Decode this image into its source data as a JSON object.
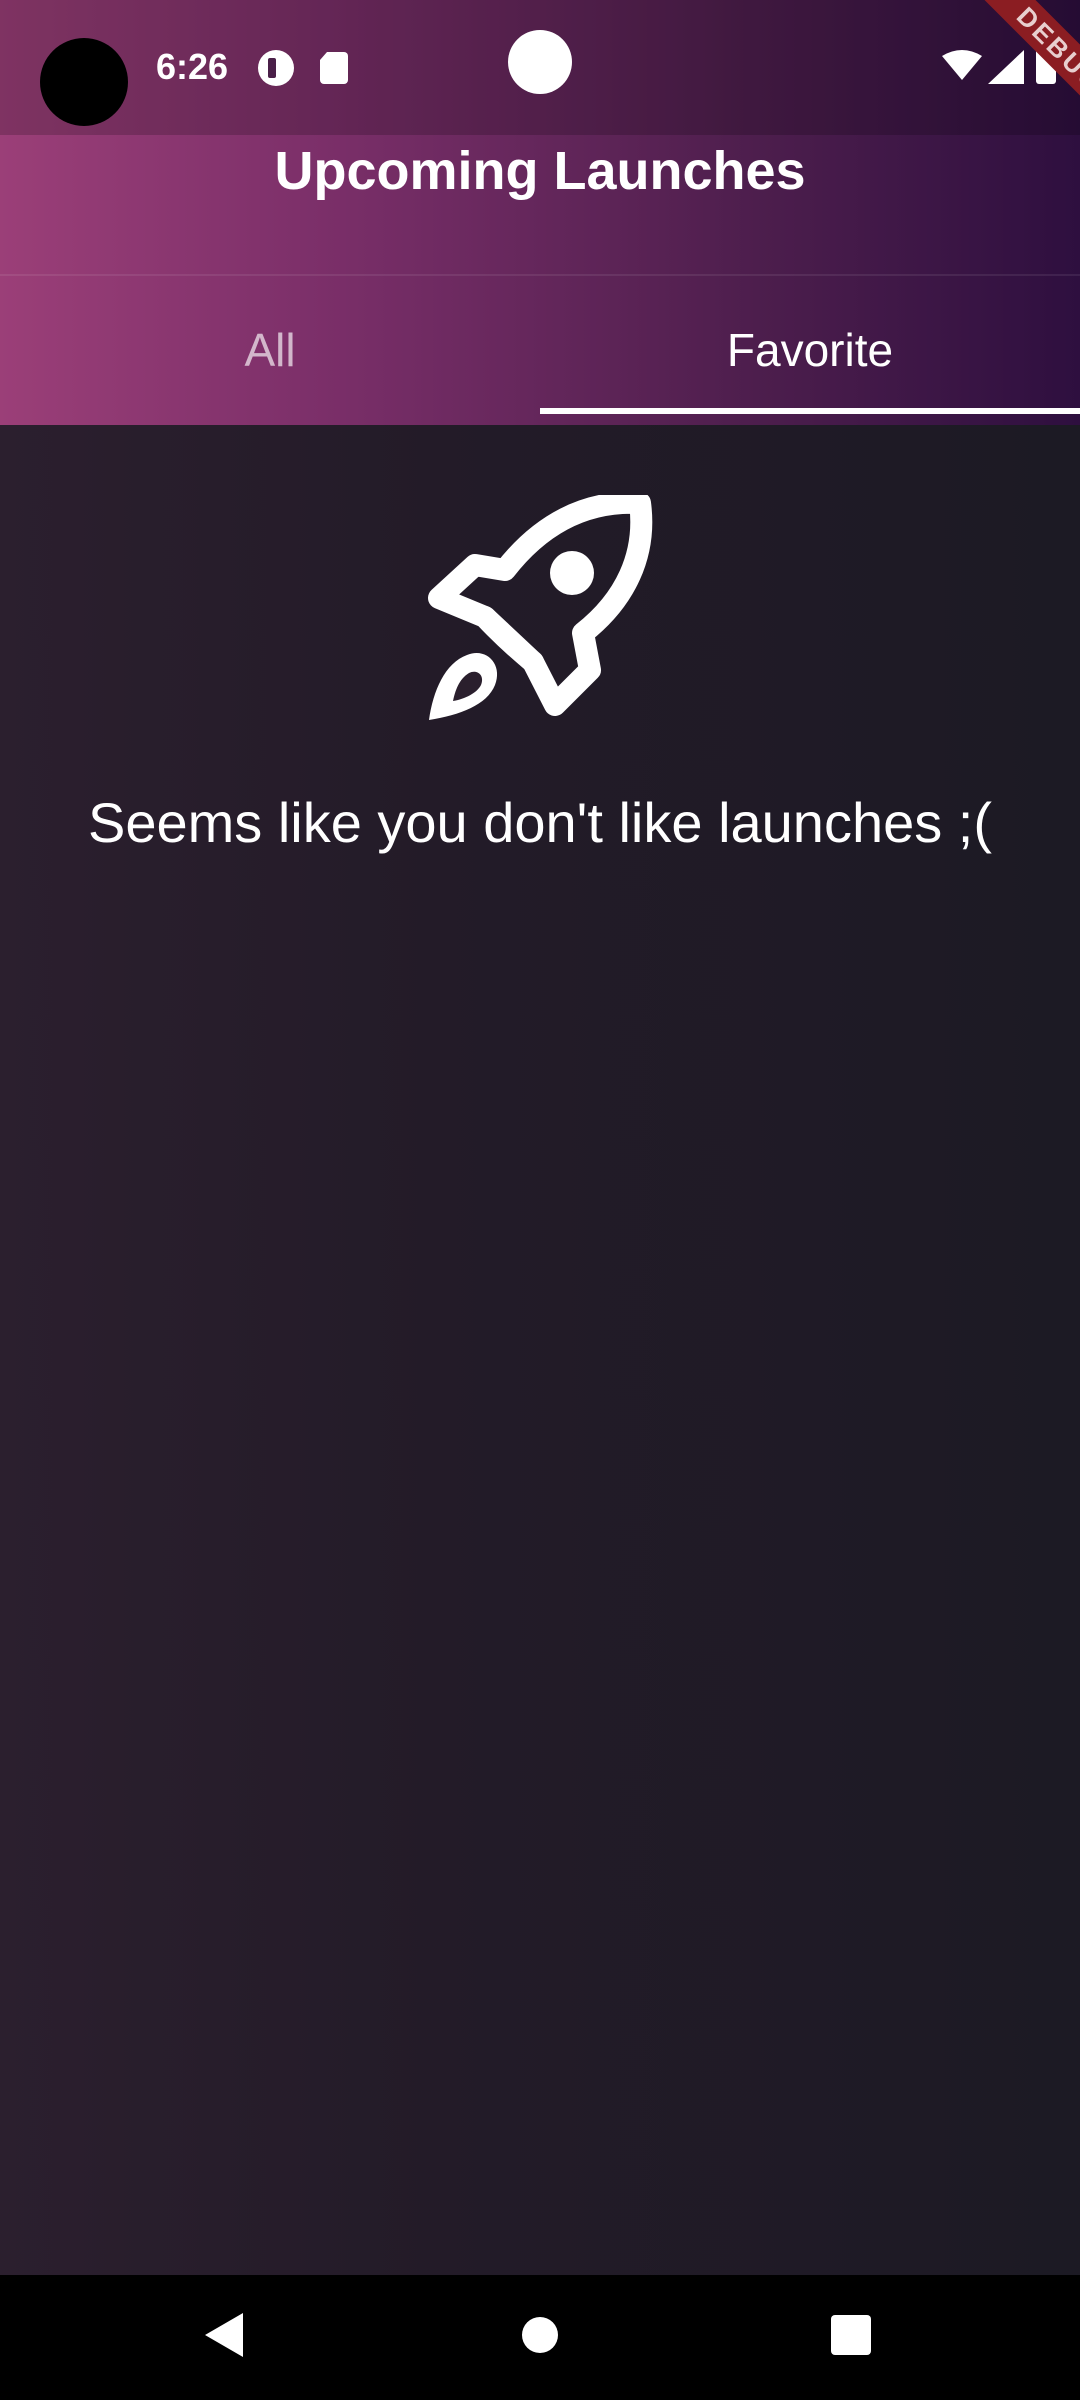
{
  "status_bar": {
    "time": "6:26"
  },
  "debug_banner": "DEBUG",
  "app_bar": {
    "title": "Upcoming Launches"
  },
  "tabs": [
    {
      "label": "All",
      "selected": false
    },
    {
      "label": "Favorite",
      "selected": true
    }
  ],
  "empty_state": {
    "icon": "rocket-icon",
    "message": "Seems like you don't like launches ;("
  },
  "colors": {
    "header_gradient_start": "#9b3f78",
    "header_gradient_end": "#2e0f3f",
    "background": "#1d1a24",
    "debug_banner": "#8b1d22"
  },
  "navigation_bar": {
    "buttons": [
      "back-icon",
      "home-icon",
      "recents-icon"
    ]
  }
}
